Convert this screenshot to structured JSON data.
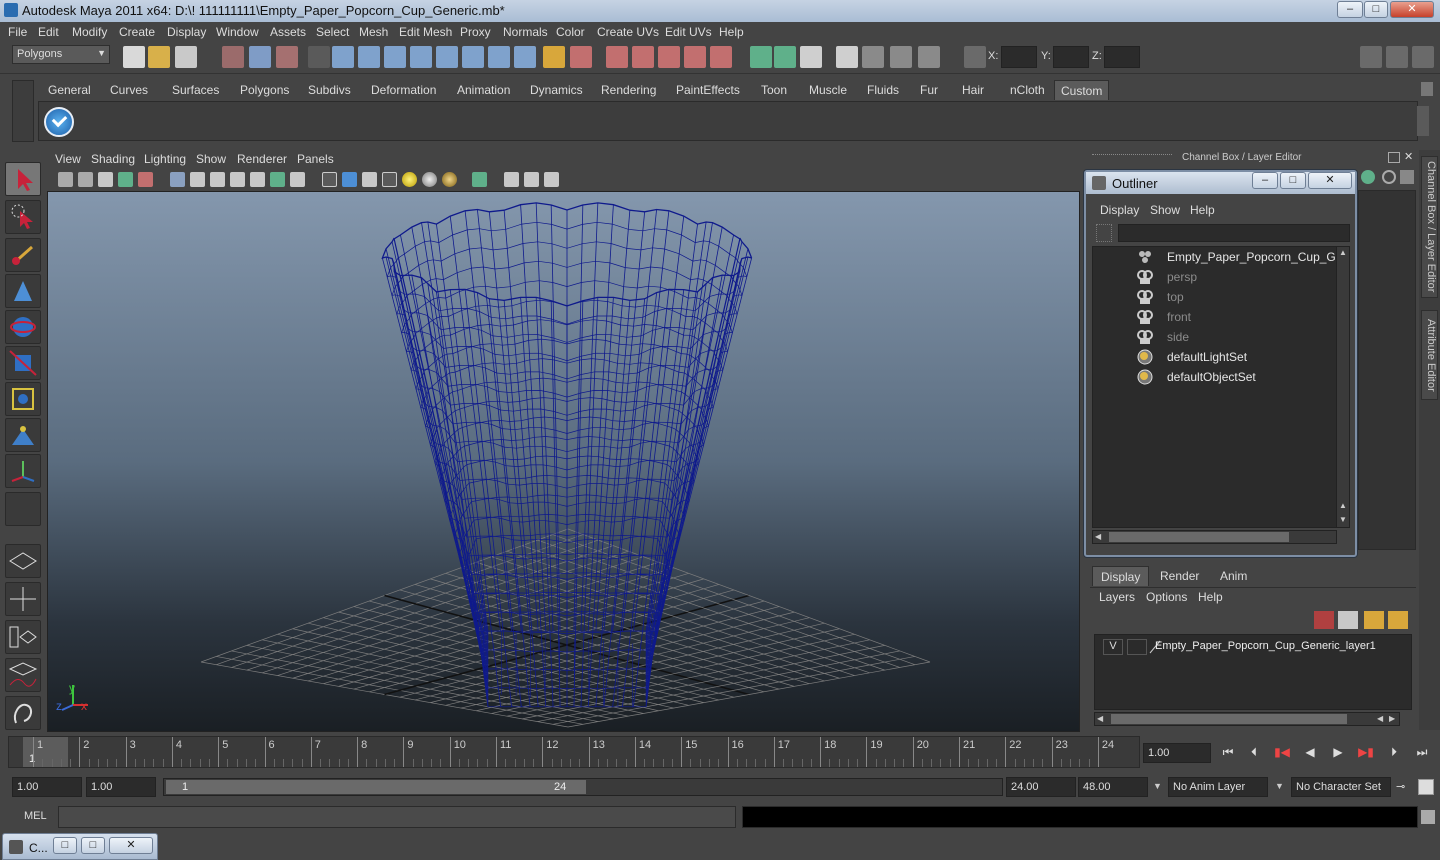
{
  "window": {
    "title": "Autodesk Maya 2011 x64: D:\\! 111111111\\Empty_Paper_Popcorn_Cup_Generic.mb*",
    "minimize": "–",
    "maximize": "□",
    "close": "✕"
  },
  "menubar": [
    "File",
    "Edit",
    "Modify",
    "Create",
    "Display",
    "Window",
    "Assets",
    "Select",
    "Mesh",
    "Edit Mesh",
    "Proxy",
    "Normals",
    "Color",
    "Create UVs",
    "Edit UVs",
    "Help"
  ],
  "status": {
    "mode": "Polygons",
    "x_label": "X:",
    "y_label": "Y:",
    "z_label": "Z:"
  },
  "shelf_tabs": [
    "General",
    "Curves",
    "Surfaces",
    "Polygons",
    "Subdivs",
    "Deformation",
    "Animation",
    "Dynamics",
    "Rendering",
    "PaintEffects",
    "Toon",
    "Muscle",
    "Fluids",
    "Fur",
    "Hair",
    "nCloth",
    "Custom"
  ],
  "shelf_active": "Custom",
  "panel_menu": [
    "View",
    "Shading",
    "Lighting",
    "Show",
    "Renderer",
    "Panels"
  ],
  "viewport": {
    "axis_x": "x",
    "axis_y": "y",
    "axis_z": "z",
    "wire_color": "#0f1a8c"
  },
  "channel_box_label": "Channel Box / Layer Editor",
  "outliner": {
    "title": "Outliner",
    "menu": [
      "Display",
      "Show",
      "Help"
    ],
    "items": [
      {
        "label": "Empty_Paper_Popcorn_Cup_Generi",
        "dim": false,
        "icon": "group-icon"
      },
      {
        "label": "persp",
        "dim": true,
        "icon": "camera-icon"
      },
      {
        "label": "top",
        "dim": true,
        "icon": "camera-icon"
      },
      {
        "label": "front",
        "dim": true,
        "icon": "camera-icon"
      },
      {
        "label": "side",
        "dim": true,
        "icon": "camera-icon"
      },
      {
        "label": "defaultLightSet",
        "dim": false,
        "icon": "set-icon"
      },
      {
        "label": "defaultObjectSet",
        "dim": false,
        "icon": "set-icon"
      }
    ]
  },
  "side_tabs": [
    "Channel Box / Layer Editor",
    "Attribute Editor"
  ],
  "layer_editor": {
    "tabs": [
      "Display",
      "Render",
      "Anim"
    ],
    "active_tab": "Display",
    "menu": [
      "Layers",
      "Options",
      "Help"
    ],
    "layers": [
      {
        "visible": "V",
        "name": "Empty_Paper_Popcorn_Cup_Generic_layer1"
      }
    ]
  },
  "timeline": {
    "ticks": [
      "1",
      "2",
      "3",
      "4",
      "5",
      "6",
      "7",
      "8",
      "9",
      "10",
      "11",
      "12",
      "13",
      "14",
      "15",
      "16",
      "17",
      "18",
      "19",
      "20",
      "21",
      "22",
      "23",
      "24"
    ],
    "current_marker": "1",
    "current_frame": "1.00"
  },
  "range": {
    "start_value": "1.00",
    "playback_start": "1.00",
    "slider_start": "1",
    "slider_end": "24",
    "playback_end": "24.00",
    "end_value": "48.00",
    "anim_layer": "No Anim Layer",
    "character_set": "No Character Set"
  },
  "command_line": {
    "label": "MEL"
  },
  "taskbar": {
    "label": "C..."
  },
  "colors": {
    "bg": "#444444",
    "accent": "#5b5b5b",
    "titlebar": "#b4c5da"
  }
}
